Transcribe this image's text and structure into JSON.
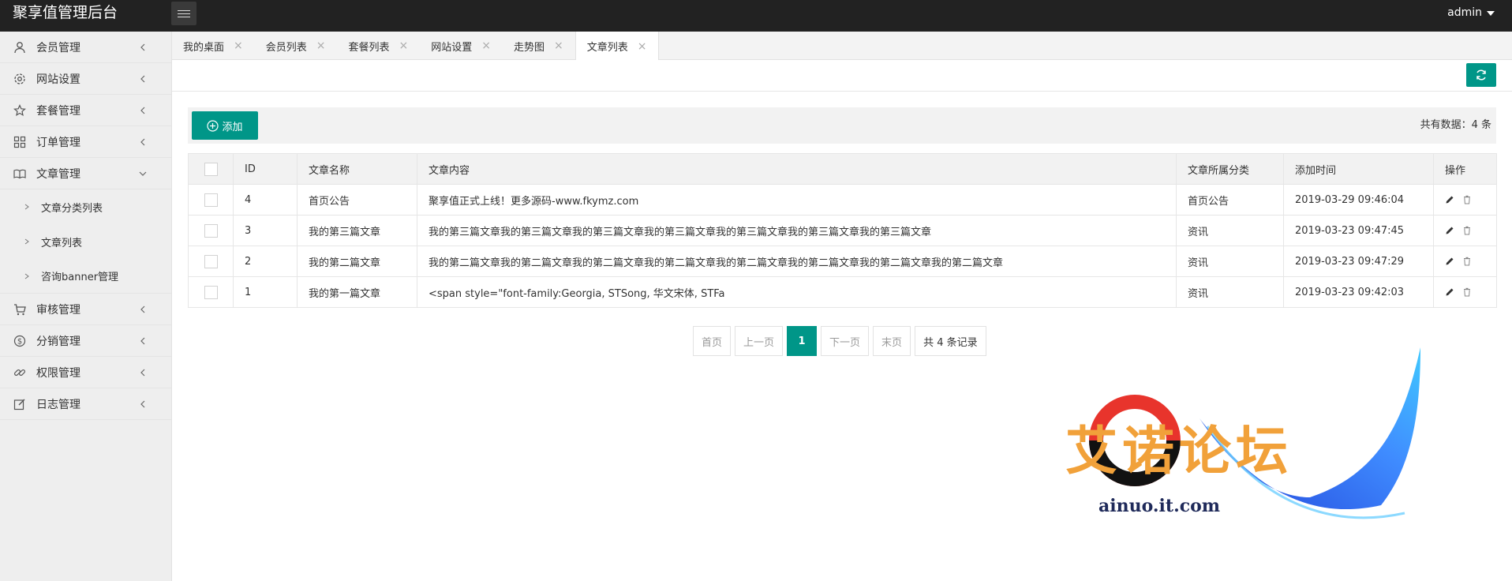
{
  "header": {
    "brand": "聚享值管理后台",
    "user": "admin"
  },
  "sidebar": {
    "items": [
      {
        "id": "member",
        "label": "会员管理",
        "icon": "user-icon"
      },
      {
        "id": "site",
        "label": "网站设置",
        "icon": "gear-icon"
      },
      {
        "id": "package",
        "label": "套餐管理",
        "icon": "star-icon"
      },
      {
        "id": "order",
        "label": "订单管理",
        "icon": "grid-icon"
      },
      {
        "id": "article",
        "label": "文章管理",
        "icon": "book-icon",
        "expanded": true,
        "children": [
          {
            "label": "文章分类列表"
          },
          {
            "label": "文章列表"
          },
          {
            "label": "咨询banner管理"
          }
        ]
      },
      {
        "id": "audit",
        "label": "审核管理",
        "icon": "cart-icon"
      },
      {
        "id": "distribution",
        "label": "分销管理",
        "icon": "dollar-icon"
      },
      {
        "id": "permission",
        "label": "权限管理",
        "icon": "link-icon"
      },
      {
        "id": "log",
        "label": "日志管理",
        "icon": "edit-icon"
      }
    ]
  },
  "tabs": [
    {
      "label": "我的桌面",
      "active": false
    },
    {
      "label": "会员列表",
      "active": false
    },
    {
      "label": "套餐列表",
      "active": false
    },
    {
      "label": "网站设置",
      "active": false
    },
    {
      "label": "走势图",
      "active": false
    },
    {
      "label": "文章列表",
      "active": true
    }
  ],
  "toolbar": {
    "add_label": "添加",
    "total_label": "共有数据：4 条"
  },
  "table": {
    "columns": [
      "ID",
      "文章名称",
      "文章内容",
      "文章所属分类",
      "添加时间",
      "操作"
    ],
    "rows": [
      {
        "id": "4",
        "name": "首页公告",
        "content": "聚享值正式上线！更多源码-www.fkymz.com",
        "category": "首页公告",
        "time": "2019-03-29 09:46:04"
      },
      {
        "id": "3",
        "name": "我的第三篇文章",
        "content": "我的第三篇文章我的第三篇文章我的第三篇文章我的第三篇文章我的第三篇文章我的第三篇文章我的第三篇文章",
        "category": "资讯",
        "time": "2019-03-23 09:47:45"
      },
      {
        "id": "2",
        "name": "我的第二篇文章",
        "content": "我的第二篇文章我的第二篇文章我的第二篇文章我的第二篇文章我的第二篇文章我的第二篇文章我的第二篇文章我的第二篇文章",
        "category": "资讯",
        "time": "2019-03-23 09:47:29"
      },
      {
        "id": "1",
        "name": "我的第一篇文章",
        "content": "<span style=\"font-family:Georgia, STSong, 华文宋体, STFa",
        "category": "资讯",
        "time": "2019-03-23 09:42:03"
      }
    ]
  },
  "pagination": {
    "first": "首页",
    "prev": "上一页",
    "current": "1",
    "next": "下一页",
    "last": "末页",
    "count": "共 4 条记录"
  },
  "watermark": {
    "text": "艾诺论坛",
    "url": "ainuo.it.com"
  },
  "colors": {
    "primary": "#009688",
    "header": "#222222",
    "sidebar": "#eeeeee"
  }
}
